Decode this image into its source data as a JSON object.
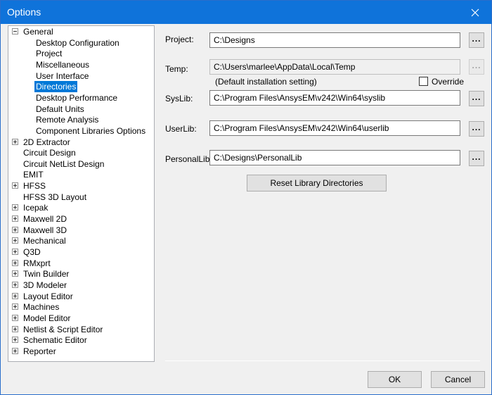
{
  "window": {
    "title": "Options"
  },
  "tree": {
    "items": [
      {
        "label": "General",
        "expander": "minus",
        "level": 0,
        "selected": false
      },
      {
        "label": "Desktop Configuration",
        "expander": "none",
        "level": 1,
        "selected": false
      },
      {
        "label": "Project",
        "expander": "none",
        "level": 1,
        "selected": false
      },
      {
        "label": "Miscellaneous",
        "expander": "none",
        "level": 1,
        "selected": false
      },
      {
        "label": "User Interface",
        "expander": "none",
        "level": 1,
        "selected": false
      },
      {
        "label": "Directories",
        "expander": "none",
        "level": 1,
        "selected": true
      },
      {
        "label": "Desktop Performance",
        "expander": "none",
        "level": 1,
        "selected": false
      },
      {
        "label": "Default Units",
        "expander": "none",
        "level": 1,
        "selected": false
      },
      {
        "label": "Remote Analysis",
        "expander": "none",
        "level": 1,
        "selected": false
      },
      {
        "label": "Component Libraries Options",
        "expander": "none",
        "level": 1,
        "selected": false
      },
      {
        "label": "2D Extractor",
        "expander": "plus",
        "level": 0,
        "selected": false
      },
      {
        "label": "Circuit Design",
        "expander": "none",
        "level": 0,
        "selected": false
      },
      {
        "label": "Circuit NetList Design",
        "expander": "none",
        "level": 0,
        "selected": false
      },
      {
        "label": "EMIT",
        "expander": "none",
        "level": 0,
        "selected": false
      },
      {
        "label": "HFSS",
        "expander": "plus",
        "level": 0,
        "selected": false
      },
      {
        "label": "HFSS 3D Layout",
        "expander": "none",
        "level": 0,
        "selected": false
      },
      {
        "label": "Icepak",
        "expander": "plus",
        "level": 0,
        "selected": false
      },
      {
        "label": "Maxwell 2D",
        "expander": "plus",
        "level": 0,
        "selected": false
      },
      {
        "label": "Maxwell 3D",
        "expander": "plus",
        "level": 0,
        "selected": false
      },
      {
        "label": "Mechanical",
        "expander": "plus",
        "level": 0,
        "selected": false
      },
      {
        "label": "Q3D",
        "expander": "plus",
        "level": 0,
        "selected": false
      },
      {
        "label": "RMxprt",
        "expander": "plus",
        "level": 0,
        "selected": false
      },
      {
        "label": "Twin Builder",
        "expander": "plus",
        "level": 0,
        "selected": false
      },
      {
        "label": "3D Modeler",
        "expander": "plus",
        "level": 0,
        "selected": false
      },
      {
        "label": "Layout Editor",
        "expander": "plus",
        "level": 0,
        "selected": false
      },
      {
        "label": "Machines",
        "expander": "plus",
        "level": 0,
        "selected": false
      },
      {
        "label": "Model Editor",
        "expander": "plus",
        "level": 0,
        "selected": false
      },
      {
        "label": "Netlist & Script Editor",
        "expander": "plus",
        "level": 0,
        "selected": false
      },
      {
        "label": "Schematic Editor",
        "expander": "plus",
        "level": 0,
        "selected": false
      },
      {
        "label": "Reporter",
        "expander": "plus",
        "level": 0,
        "selected": false
      }
    ]
  },
  "fields": {
    "project": {
      "label": "Project:",
      "value": "C:\\Designs",
      "browse": "..."
    },
    "temp": {
      "label": "Temp:",
      "value": "C:\\Users\\marlee\\AppData\\Local\\Temp",
      "browse": "...",
      "note": "(Default installation setting)",
      "override_label": "Override",
      "override_checked": false
    },
    "syslib": {
      "label": "SysLib:",
      "value": "C:\\Program Files\\AnsysEM\\v242\\Win64\\syslib",
      "browse": "..."
    },
    "userlib": {
      "label": "UserLib:",
      "value": "C:\\Program Files\\AnsysEM\\v242\\Win64\\userlib",
      "browse": "..."
    },
    "personallib": {
      "label": "PersonalLib:",
      "value": "C:\\Designs\\PersonalLib",
      "browse": "..."
    }
  },
  "buttons": {
    "reset": "Reset Library Directories",
    "ok": "OK",
    "cancel": "Cancel"
  },
  "icons": {
    "close": "close-icon",
    "expand": "plus-expander-icon",
    "collapse": "minus-expander-icon"
  },
  "colors": {
    "titlebar": "#0f73da",
    "selection": "#0078d7"
  }
}
